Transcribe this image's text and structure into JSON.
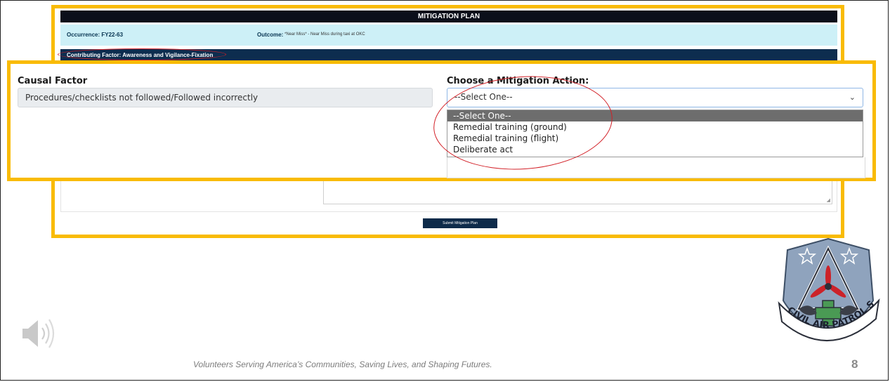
{
  "form": {
    "header_title": "MITIGATION PLAN",
    "occurrence_label": "Occurrence: FY22-63",
    "outcome_label": "Outcome:",
    "outcome_value": "*Near Miss* - Near Miss during taxi at OKC",
    "contributing_factor": "Contributing Factor: Awareness and Vigilance-Fixation",
    "submit_label": "Submit Mitigation Plan",
    "resize_grip": "◢"
  },
  "zoom": {
    "causal_factor_heading": "Causal Factor",
    "causal_factor_value": "Procedures/checklists not followed/Followed incorrectly",
    "mitigation_heading": "Choose a Mitigation Action:",
    "selected_value": "--Select One--",
    "chevron_glyph": "⌄",
    "options": [
      "--Select One--",
      "Remedial training (ground)",
      "Remedial training (flight)",
      "Deliberate act"
    ]
  },
  "footer": {
    "tagline": "Volunteers Serving America’s Communities, Saving Lives, and Shaping Futures.",
    "page_number": "8"
  },
  "seal": {
    "text": "CIVIL AIR PATROL SAFETY"
  },
  "colors": {
    "highlight_border": "#f9bb05",
    "annotation_circle": "#d21f26",
    "header_bar": "#0b0f1a",
    "occurrence_row": "#cdf0f7",
    "contributing_bar": "#0d2d4f"
  },
  "icons": {
    "speaker": "speaker-icon",
    "seal": "civil-air-patrol-safety-seal"
  }
}
